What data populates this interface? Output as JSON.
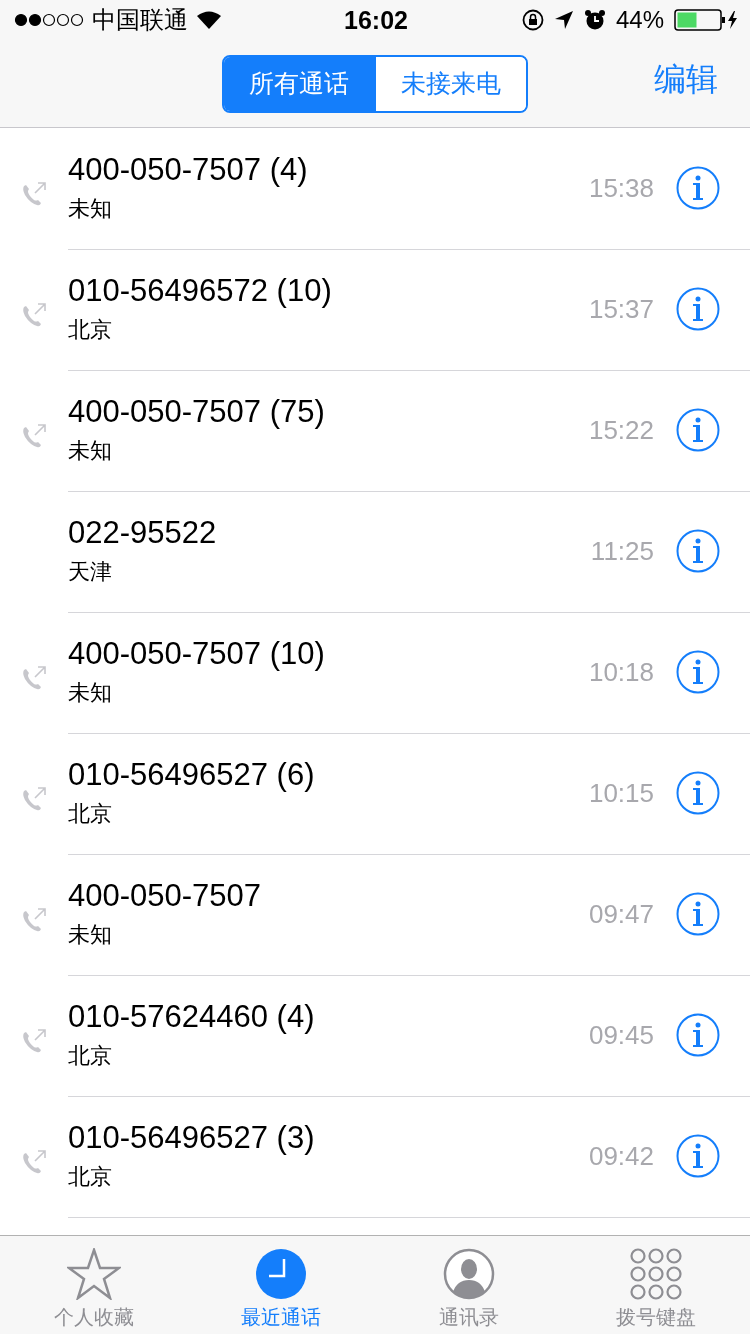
{
  "status_bar": {
    "carrier": "中国联通",
    "time": "16:02",
    "battery": "44%"
  },
  "segments": [
    {
      "label": "所有通话",
      "selected": true
    },
    {
      "label": "未接来电",
      "selected": false
    }
  ],
  "edit_button": "编辑",
  "calls": [
    {
      "number": "400-050-7507 (4)",
      "location": "未知",
      "time": "15:38",
      "outgoing": true
    },
    {
      "number": "010-56496572 (10)",
      "location": "北京",
      "time": "15:37",
      "outgoing": true
    },
    {
      "number": "400-050-7507 (75)",
      "location": "未知",
      "time": "15:22",
      "outgoing": true
    },
    {
      "number": "022-95522",
      "location": "天津",
      "time": "11:25",
      "outgoing": false
    },
    {
      "number": "400-050-7507 (10)",
      "location": "未知",
      "time": "10:18",
      "outgoing": true
    },
    {
      "number": "010-56496527 (6)",
      "location": "北京",
      "time": "10:15",
      "outgoing": true
    },
    {
      "number": "400-050-7507",
      "location": "未知",
      "time": "09:47",
      "outgoing": true
    },
    {
      "number": "010-57624460 (4)",
      "location": "北京",
      "time": "09:45",
      "outgoing": true
    },
    {
      "number": "010-56496527 (3)",
      "location": "北京",
      "time": "09:42",
      "outgoing": true
    }
  ],
  "tab_bar": [
    {
      "label": "个人收藏",
      "kind": "star",
      "selected": false
    },
    {
      "label": "最近通话",
      "kind": "clock",
      "selected": true
    },
    {
      "label": "通讯录",
      "kind": "contact",
      "selected": false
    },
    {
      "label": "拨号键盘",
      "kind": "keypad",
      "selected": false
    }
  ]
}
